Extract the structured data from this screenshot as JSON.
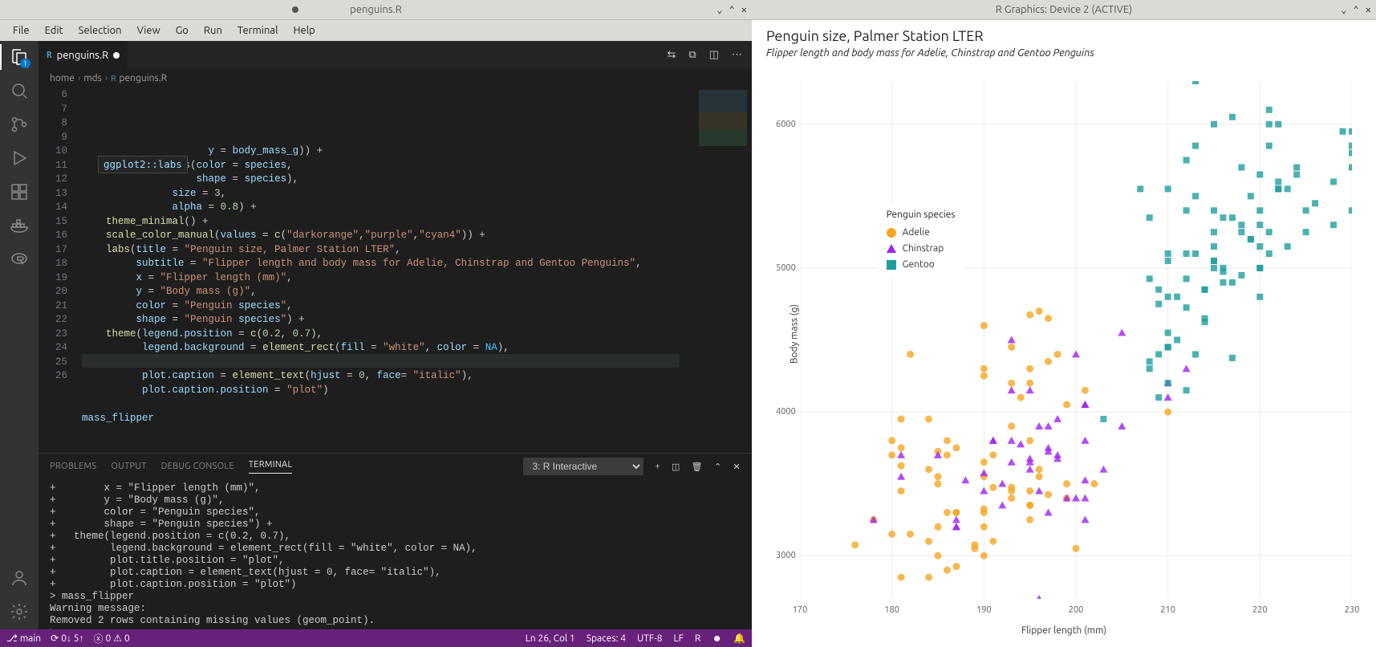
{
  "left_title": "penguins.R",
  "right_title": "R Graphics: Device 2 (ACTIVE)",
  "menubar": [
    "File",
    "Edit",
    "Selection",
    "View",
    "Go",
    "Run",
    "Terminal",
    "Help"
  ],
  "activity_badge": "1",
  "tab": {
    "filename": "penguins.R"
  },
  "editor_actions": [
    "⇄",
    "⎘",
    "▭",
    "⋯"
  ],
  "breadcrumbs": [
    "home",
    "mds",
    "penguins.R"
  ],
  "hint": "ggplot2::labs",
  "gutter_start": 6,
  "gutter_end": 26,
  "code_lines": [
    "                     y = body_mass_g)) +",
    "    geom_point(aes(color = species,",
    "                   shape = species),",
    "               size = 3,",
    "               alpha = 0.8) +",
    "    theme_minimal() +",
    "    scale_color_manual(values = c(\"darkorange\",\"purple\",\"cyan4\")) +",
    "    labs(title = \"Penguin size, Palmer Station LTER\",",
    "         subtitle = \"Flipper length and body mass for Adelie, Chinstrap and Gentoo Penguins\",",
    "         x = \"Flipper length (mm)\",",
    "         y = \"Body mass (g)\",",
    "         color = \"Penguin species\",",
    "         shape = \"Penguin species\") +",
    "    theme(legend.position = c(0.2, 0.7),",
    "          legend.background = element_rect(fill = \"white\", color = NA),",
    "          plot.title.position = \"plot\",",
    "          plot.caption = element_text(hjust = 0, face= \"italic\"),",
    "          plot.caption.position = \"plot\")",
    "",
    "mass_flipper",
    ""
  ],
  "panel": {
    "tabs": [
      "PROBLEMS",
      "OUTPUT",
      "DEBUG CONSOLE",
      "TERMINAL"
    ],
    "active_tab": "TERMINAL",
    "terminal_selector": "3: R Interactive",
    "body": "+        x = \"Flipper length (mm)\",\n+        y = \"Body mass (g)\",\n+        color = \"Penguin species\",\n+        shape = \"Penguin species\") +\n+   theme(legend.position = c(0.2, 0.7),\n+         legend.background = element_rect(fill = \"white\", color = NA),\n+         plot.title.position = \"plot\",\n+         plot.caption = element_text(hjust = 0, face= \"italic\"),\n+         plot.caption.position = \"plot\")\n> mass_flipper\nWarning message:\nRemoved 2 rows containing missing values (geom_point).\n> ▯"
  },
  "statusbar": {
    "branch": "main",
    "sync": "0↓ 5↑",
    "errors": "0",
    "warnings": "0",
    "cursor": "Ln 26, Col 1",
    "spaces": "Spaces: 4",
    "encoding": "UTF-8",
    "eol": "LF",
    "lang": "R"
  },
  "chart_data": {
    "type": "scatter",
    "title": "Penguin size, Palmer Station LTER",
    "subtitle": "Flipper length and body mass for Adelie, Chinstrap and Gentoo Penguins",
    "xlabel": "Flipper length (mm)",
    "ylabel": "Body mass (g)",
    "xlim": [
      170,
      230
    ],
    "ylim": [
      2700,
      6300
    ],
    "x_ticks": [
      170,
      180,
      190,
      200,
      210,
      220,
      230
    ],
    "y_ticks": [
      3000,
      4000,
      5000,
      6000
    ],
    "legend_title": "Penguin species",
    "legend_pos": {
      "x_frac": 0.2,
      "y_frac": 0.3
    },
    "series": [
      {
        "name": "Adelie",
        "color": "#f5a623",
        "shape": "circle",
        "points": [
          [
            181,
            3750
          ],
          [
            186,
            3800
          ],
          [
            195,
            3250
          ],
          [
            193,
            3450
          ],
          [
            190,
            3650
          ],
          [
            181,
            3625
          ],
          [
            195,
            4675
          ],
          [
            193,
            3475
          ],
          [
            190,
            4250
          ],
          [
            186,
            3300
          ],
          [
            180,
            3700
          ],
          [
            185,
            3200
          ],
          [
            180,
            3800
          ],
          [
            178,
            3250
          ],
          [
            184,
            3950
          ],
          [
            195,
            3800
          ],
          [
            196,
            3550
          ],
          [
            190,
            3300
          ],
          [
            180,
            3150
          ],
          [
            181,
            3950
          ],
          [
            184,
            3100
          ],
          [
            182,
            4400
          ],
          [
            195,
            4200
          ],
          [
            186,
            2900
          ],
          [
            196,
            4700
          ],
          [
            185,
            3550
          ],
          [
            190,
            3200
          ],
          [
            182,
            3150
          ],
          [
            191,
            3100
          ],
          [
            198,
            4400
          ],
          [
            185,
            3000
          ],
          [
            195,
            4300
          ],
          [
            197,
            4350
          ],
          [
            184,
            2850
          ],
          [
            195,
            3350
          ],
          [
            189,
            3050
          ],
          [
            196,
            3600
          ],
          [
            187,
            3300
          ],
          [
            193,
            3400
          ],
          [
            181,
            2850
          ],
          [
            194,
            4100
          ],
          [
            185,
            3725
          ],
          [
            189,
            3075
          ],
          [
            187,
            2925
          ],
          [
            187,
            3750
          ],
          [
            199,
            4050
          ],
          [
            176,
            3075
          ],
          [
            202,
            3500
          ],
          [
            186,
            3700
          ],
          [
            199,
            3500
          ],
          [
            191,
            3475
          ],
          [
            195,
            3450
          ],
          [
            191,
            3700
          ],
          [
            210,
            4000
          ],
          [
            190,
            4600
          ],
          [
            197,
            3425
          ],
          [
            193,
            4200
          ],
          [
            199,
            3400
          ],
          [
            190,
            4300
          ],
          [
            200,
            3050
          ],
          [
            193,
            4450
          ],
          [
            187,
            3300
          ],
          [
            190,
            3325
          ],
          [
            185,
            3500
          ],
          [
            184,
            3600
          ],
          [
            195,
            3350
          ],
          [
            193,
            3900
          ],
          [
            201,
            4150
          ],
          [
            190,
            3000
          ],
          [
            197,
            4650
          ],
          [
            181,
            3450
          ],
          [
            190,
            3550
          ]
        ]
      },
      {
        "name": "Chinstrap",
        "color": "#a020f0",
        "shape": "triangle",
        "points": [
          [
            192,
            3500
          ],
          [
            196,
            3900
          ],
          [
            193,
            3650
          ],
          [
            188,
            3525
          ],
          [
            197,
            3725
          ],
          [
            198,
            3950
          ],
          [
            178,
            3250
          ],
          [
            197,
            3750
          ],
          [
            195,
            4150
          ],
          [
            198,
            3700
          ],
          [
            193,
            3800
          ],
          [
            194,
            3775
          ],
          [
            185,
            3700
          ],
          [
            201,
            4050
          ],
          [
            190,
            3575
          ],
          [
            201,
            4050
          ],
          [
            197,
            3300
          ],
          [
            181,
            3700
          ],
          [
            190,
            3450
          ],
          [
            195,
            3650
          ],
          [
            181,
            3550
          ],
          [
            191,
            3800
          ],
          [
            187,
            3200
          ],
          [
            193,
            4150
          ],
          [
            195,
            3600
          ],
          [
            197,
            3900
          ],
          [
            200,
            4400
          ],
          [
            200,
            3400
          ],
          [
            191,
            3800
          ],
          [
            205,
            4550
          ],
          [
            187,
            3200
          ],
          [
            201,
            3400
          ],
          [
            203,
            3600
          ],
          [
            195,
            3675
          ],
          [
            210,
            4200
          ],
          [
            205,
            3900
          ],
          [
            210,
            4100
          ],
          [
            196,
            2700
          ],
          [
            192,
            3350
          ],
          [
            201,
            3250
          ],
          [
            196,
            3450
          ],
          [
            201,
            3525
          ],
          [
            212,
            4300
          ],
          [
            187,
            3250
          ],
          [
            198,
            3675
          ],
          [
            199,
            3400
          ],
          [
            201,
            3800
          ],
          [
            193,
            4500
          ]
        ]
      },
      {
        "name": "Gentoo",
        "color": "#1f9e9e",
        "shape": "square",
        "points": [
          [
            211,
            4500
          ],
          [
            230,
            5700
          ],
          [
            210,
            4450
          ],
          [
            218,
            5700
          ],
          [
            215,
            5400
          ],
          [
            210,
            4550
          ],
          [
            211,
            4800
          ],
          [
            219,
            5200
          ],
          [
            209,
            4400
          ],
          [
            215,
            5150
          ],
          [
            214,
            4650
          ],
          [
            216,
            4900
          ],
          [
            214,
            4850
          ],
          [
            213,
            6300
          ],
          [
            210,
            4800
          ],
          [
            217,
            5350
          ],
          [
            210,
            4200
          ],
          [
            221,
            5850
          ],
          [
            209,
            4750
          ],
          [
            222,
            5600
          ],
          [
            218,
            5250
          ],
          [
            215,
            6000
          ],
          [
            213,
            4400
          ],
          [
            215,
            5250
          ],
          [
            210,
            5100
          ],
          [
            220,
            5650
          ],
          [
            210,
            5550
          ],
          [
            225,
            5250
          ],
          [
            217,
            6050
          ],
          [
            220,
            5150
          ],
          [
            208,
            4350
          ],
          [
            208,
            5350
          ],
          [
            224,
            5700
          ],
          [
            208,
            4925
          ],
          [
            221,
            6000
          ],
          [
            214,
            4850
          ],
          [
            231,
            5750
          ],
          [
            219,
            5200
          ],
          [
            230,
            5800
          ],
          [
            229,
            5950
          ],
          [
            220,
            5400
          ],
          [
            223,
            5550
          ],
          [
            221,
            5250
          ],
          [
            221,
            6100
          ],
          [
            217,
            4375
          ],
          [
            216,
            4975
          ],
          [
            230,
            5950
          ],
          [
            209,
            4850
          ],
          [
            220,
            5000
          ],
          [
            215,
            5050
          ],
          [
            223,
            5150
          ],
          [
            212,
            5400
          ],
          [
            221,
            5100
          ],
          [
            224,
            5650
          ],
          [
            212,
            4925
          ],
          [
            228,
            5600
          ],
          [
            218,
            4950
          ],
          [
            212,
            5750
          ],
          [
            230,
            5400
          ],
          [
            218,
            5300
          ],
          [
            228,
            5300
          ],
          [
            212,
            4150
          ],
          [
            226,
            5450
          ],
          [
            216,
            5350
          ],
          [
            222,
            5550
          ],
          [
            203,
            3950
          ],
          [
            219,
            5500
          ],
          [
            208,
            4300
          ],
          [
            216,
            5000
          ],
          [
            210,
            4450
          ],
          [
            213,
            5850
          ],
          [
            217,
            4900
          ],
          [
            214,
            4625
          ],
          [
            215,
            5050
          ],
          [
            222,
            6000
          ],
          [
            212,
            4725
          ],
          [
            213,
            5100
          ],
          [
            225,
            5400
          ],
          [
            215,
            5000
          ],
          [
            210,
            5050
          ],
          [
            220,
            5000
          ],
          [
            222,
            5550
          ],
          [
            209,
            4100
          ],
          [
            207,
            5550
          ],
          [
            230,
            5850
          ],
          [
            220,
            5300
          ],
          [
            220,
            4800
          ],
          [
            213,
            5500
          ],
          [
            212,
            5100
          ]
        ]
      }
    ]
  }
}
